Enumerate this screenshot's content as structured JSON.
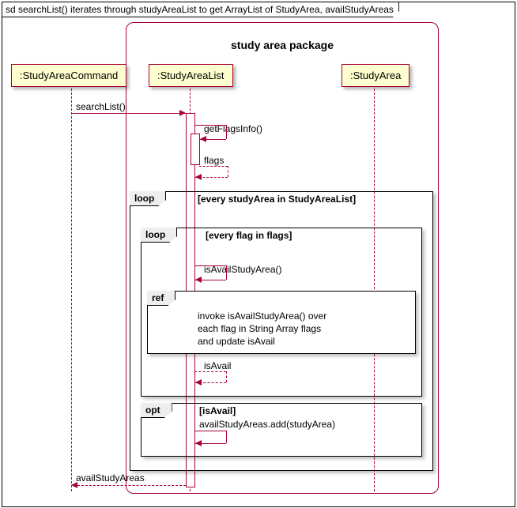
{
  "sd_title": "sd searchList() iterates through studyAreaList to get ArrayList of StudyArea, availStudyAreas",
  "package_title": "study area package",
  "participants": {
    "cmd": ":StudyAreaCommand",
    "list": ":StudyAreaList",
    "area": ":StudyArea"
  },
  "messages": {
    "searchList": "searchList()",
    "getFlagsInfo": "getFlagsInfo()",
    "flags": "flags",
    "isAvailStudyArea": "isAvailStudyArea()",
    "isAvail": "isAvail",
    "addStudyArea": "availStudyAreas.add(studyArea)",
    "returnAvail": "availStudyAreas"
  },
  "fragments": {
    "loop1": {
      "label": "loop",
      "guard": "[every studyArea in StudyAreaList]"
    },
    "loop2": {
      "label": "loop",
      "guard": "[every flag in flags]"
    },
    "ref": {
      "label": "ref",
      "text": "invoke isAvailStudyArea() over\neach flag in String Array flags\nand update isAvail"
    },
    "opt": {
      "label": "opt",
      "guard": "[isAvail]"
    }
  },
  "chart_data": {
    "type": "sequence_diagram",
    "participants": [
      "StudyAreaCommand",
      "StudyAreaList",
      "StudyArea"
    ],
    "package": {
      "name": "study area package",
      "members": [
        "StudyAreaList",
        "StudyArea"
      ]
    },
    "interactions": [
      {
        "from": "StudyAreaCommand",
        "to": "StudyAreaList",
        "message": "searchList()",
        "type": "sync"
      },
      {
        "from": "StudyAreaList",
        "to": "StudyAreaList",
        "message": "getFlagsInfo()",
        "type": "self-sync"
      },
      {
        "from": "StudyAreaList",
        "to": "StudyAreaList",
        "message": "flags",
        "type": "self-return"
      },
      {
        "fragment": "loop",
        "guard": "every studyArea in StudyAreaList",
        "body": [
          {
            "fragment": "loop",
            "guard": "every flag in flags",
            "body": [
              {
                "from": "StudyAreaList",
                "to": "StudyAreaList",
                "message": "isAvailStudyArea()",
                "type": "self-sync"
              },
              {
                "fragment": "ref",
                "text": "invoke isAvailStudyArea() over each flag in String Array flags and update isAvail"
              },
              {
                "from": "StudyAreaList",
                "to": "StudyAreaList",
                "message": "isAvail",
                "type": "self-return"
              }
            ]
          },
          {
            "fragment": "opt",
            "guard": "isAvail",
            "body": [
              {
                "from": "StudyAreaList",
                "to": "StudyAreaList",
                "message": "availStudyAreas.add(studyArea)",
                "type": "self-sync"
              }
            ]
          }
        ]
      },
      {
        "from": "StudyAreaList",
        "to": "StudyAreaCommand",
        "message": "availStudyAreas",
        "type": "return"
      }
    ]
  }
}
